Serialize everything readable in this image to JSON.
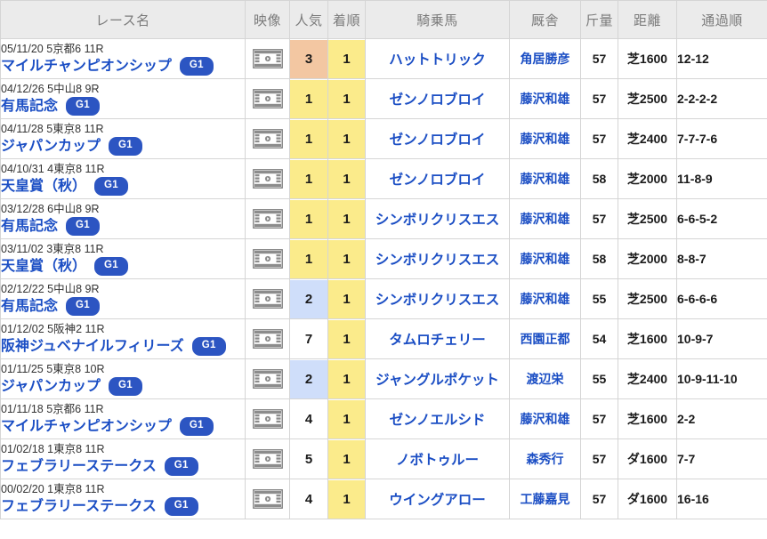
{
  "table": {
    "columns": [
      {
        "key": "race",
        "label": "レース名"
      },
      {
        "key": "video",
        "label": "映像"
      },
      {
        "key": "pop",
        "label": "人気"
      },
      {
        "key": "rank",
        "label": "着順"
      },
      {
        "key": "horse",
        "label": "騎乗馬"
      },
      {
        "key": "stable",
        "label": "厩舎"
      },
      {
        "key": "weight",
        "label": "斤量"
      },
      {
        "key": "dist",
        "label": "距離"
      },
      {
        "key": "pass",
        "label": "通過順"
      }
    ],
    "colors": {
      "header_bg": "#ebebeb",
      "header_text": "#7b7b7b",
      "link_blue": "#1b4ec4",
      "grade_badge_bg": "#2c55c2",
      "highlight_yellow": "#fbeb8b",
      "highlight_peach": "#f3c7a2",
      "highlight_blue": "#cfdefa",
      "border": "#d5d5d5",
      "video_icon": "#8c8c8c"
    },
    "video_icon_name": "video-film-play-icon",
    "rows": [
      {
        "meta": "05/11/20 5京都6 11R",
        "name": "マイルチャンピオンシップ",
        "grade": "G1",
        "video": "video-film-play-icon",
        "pop": "3",
        "pop_fill": "peach",
        "rank": "1",
        "rank_fill": "yellow",
        "horse": "ハットトリック",
        "stable": "角居勝彦",
        "weight": "57",
        "dist": "芝1600",
        "pass": "12-12"
      },
      {
        "meta": "04/12/26 5中山8 9R",
        "name": "有馬記念",
        "grade": "G1",
        "video": "video-film-play-icon",
        "pop": "1",
        "pop_fill": "yellow",
        "rank": "1",
        "rank_fill": "yellow",
        "horse": "ゼンノロブロイ",
        "stable": "藤沢和雄",
        "weight": "57",
        "dist": "芝2500",
        "pass": "2-2-2-2"
      },
      {
        "meta": "04/11/28 5東京8 11R",
        "name": "ジャパンカップ",
        "grade": "G1",
        "video": "video-film-play-icon",
        "pop": "1",
        "pop_fill": "yellow",
        "rank": "1",
        "rank_fill": "yellow",
        "horse": "ゼンノロブロイ",
        "stable": "藤沢和雄",
        "weight": "57",
        "dist": "芝2400",
        "pass": "7-7-7-6"
      },
      {
        "meta": "04/10/31 4東京8 11R",
        "name": "天皇賞（秋）",
        "grade": "G1",
        "video": "video-film-play-icon",
        "pop": "1",
        "pop_fill": "yellow",
        "rank": "1",
        "rank_fill": "yellow",
        "horse": "ゼンノロブロイ",
        "stable": "藤沢和雄",
        "weight": "58",
        "dist": "芝2000",
        "pass": "11-8-9"
      },
      {
        "meta": "03/12/28 6中山8 9R",
        "name": "有馬記念",
        "grade": "G1",
        "video": "video-film-play-icon",
        "pop": "1",
        "pop_fill": "yellow",
        "rank": "1",
        "rank_fill": "yellow",
        "horse": "シンボリクリスエス",
        "stable": "藤沢和雄",
        "weight": "57",
        "dist": "芝2500",
        "pass": "6-6-5-2"
      },
      {
        "meta": "03/11/02 3東京8 11R",
        "name": "天皇賞（秋）",
        "grade": "G1",
        "video": "video-film-play-icon",
        "pop": "1",
        "pop_fill": "yellow",
        "rank": "1",
        "rank_fill": "yellow",
        "horse": "シンボリクリスエス",
        "stable": "藤沢和雄",
        "weight": "58",
        "dist": "芝2000",
        "pass": "8-8-7"
      },
      {
        "meta": "02/12/22 5中山8 9R",
        "name": "有馬記念",
        "grade": "G1",
        "video": "video-film-play-icon",
        "pop": "2",
        "pop_fill": "blue",
        "rank": "1",
        "rank_fill": "yellow",
        "horse": "シンボリクリスエス",
        "stable": "藤沢和雄",
        "weight": "55",
        "dist": "芝2500",
        "pass": "6-6-6-6"
      },
      {
        "meta": "01/12/02 5阪神2 11R",
        "name": "阪神ジュベナイルフィリーズ",
        "grade": "G1",
        "video": "video-film-play-icon",
        "pop": "7",
        "pop_fill": "none",
        "rank": "1",
        "rank_fill": "yellow",
        "horse": "タムロチェリー",
        "stable": "西園正都",
        "weight": "54",
        "dist": "芝1600",
        "pass": "10-9-7"
      },
      {
        "meta": "01/11/25 5東京8 10R",
        "name": "ジャパンカップ",
        "grade": "G1",
        "video": "video-film-play-icon",
        "pop": "2",
        "pop_fill": "blue",
        "rank": "1",
        "rank_fill": "yellow",
        "horse": "ジャングルポケット",
        "stable": "渡辺栄",
        "weight": "55",
        "dist": "芝2400",
        "pass": "10-9-11-10"
      },
      {
        "meta": "01/11/18 5京都6 11R",
        "name": "マイルチャンピオンシップ",
        "grade": "G1",
        "video": "video-film-play-icon",
        "pop": "4",
        "pop_fill": "none",
        "rank": "1",
        "rank_fill": "yellow",
        "horse": "ゼンノエルシド",
        "stable": "藤沢和雄",
        "weight": "57",
        "dist": "芝1600",
        "pass": "2-2"
      },
      {
        "meta": "01/02/18 1東京8 11R",
        "name": "フェブラリーステークス",
        "grade": "G1",
        "video": "video-film-play-icon",
        "pop": "5",
        "pop_fill": "none",
        "rank": "1",
        "rank_fill": "yellow",
        "horse": "ノボトゥルー",
        "stable": "森秀行",
        "weight": "57",
        "dist": "ダ1600",
        "pass": "7-7"
      },
      {
        "meta": "00/02/20 1東京8 11R",
        "name": "フェブラリーステークス",
        "grade": "G1",
        "video": "video-film-play-icon",
        "pop": "4",
        "pop_fill": "none",
        "rank": "1",
        "rank_fill": "yellow",
        "horse": "ウイングアロー",
        "stable": "工藤嘉見",
        "weight": "57",
        "dist": "ダ1600",
        "pass": "16-16"
      }
    ]
  }
}
